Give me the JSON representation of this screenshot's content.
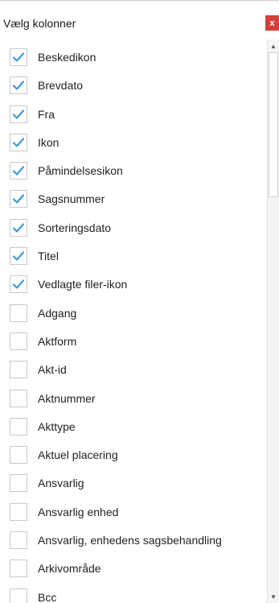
{
  "panel": {
    "title": "Vælg kolonner",
    "close_label": "x"
  },
  "colors": {
    "close_button": "#d43f3a",
    "check_mark": "#3c9ad8",
    "checkbox_border": "#c8c8c8"
  },
  "scrollbar": {
    "up_glyph": "▲",
    "down_glyph": "▼"
  },
  "columns": [
    {
      "label": "Beskedikon",
      "checked": true
    },
    {
      "label": "Brevdato",
      "checked": true
    },
    {
      "label": "Fra",
      "checked": true
    },
    {
      "label": "Ikon",
      "checked": true
    },
    {
      "label": "Påmindelsesikon",
      "checked": true
    },
    {
      "label": "Sagsnummer",
      "checked": true
    },
    {
      "label": "Sorteringsdato",
      "checked": true
    },
    {
      "label": "Titel",
      "checked": true
    },
    {
      "label": "Vedlagte filer-ikon",
      "checked": true
    },
    {
      "label": "Adgang",
      "checked": false
    },
    {
      "label": "Aktform",
      "checked": false
    },
    {
      "label": "Akt-id",
      "checked": false
    },
    {
      "label": "Aktnummer",
      "checked": false
    },
    {
      "label": "Akttype",
      "checked": false
    },
    {
      "label": "Aktuel placering",
      "checked": false
    },
    {
      "label": "Ansvarlig",
      "checked": false
    },
    {
      "label": "Ansvarlig enhed",
      "checked": false
    },
    {
      "label": "Ansvarlig, enhedens sagsbehandling",
      "checked": false
    },
    {
      "label": "Arkivområde",
      "checked": false
    },
    {
      "label": "Bcc",
      "checked": false
    }
  ]
}
